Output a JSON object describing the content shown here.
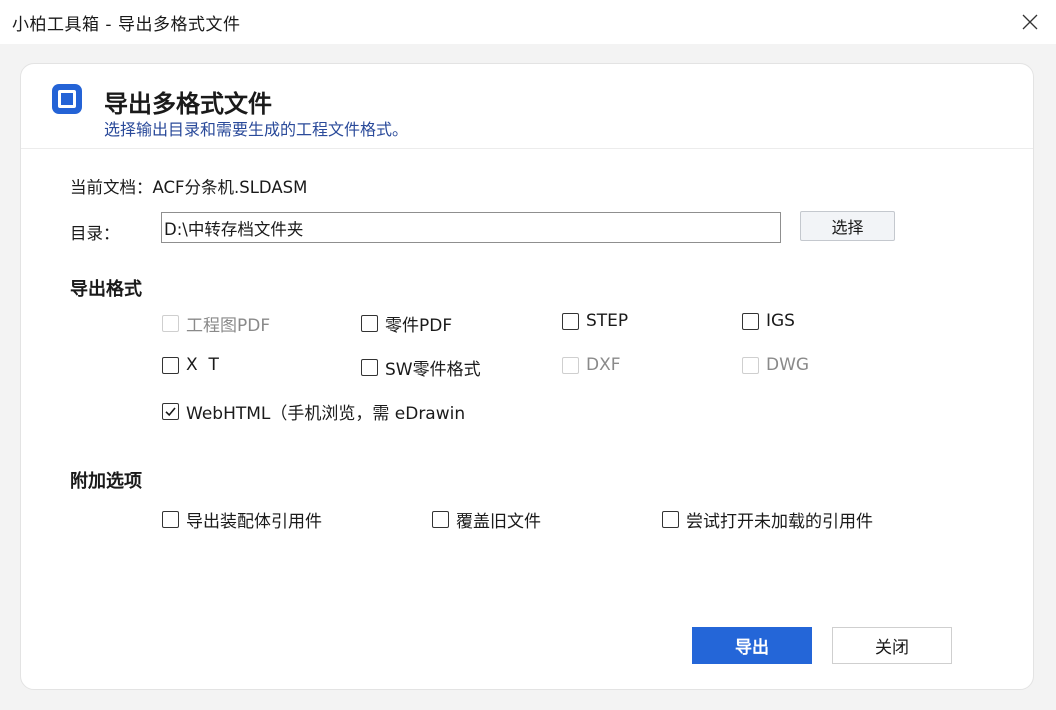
{
  "window": {
    "title": "小柏工具箱 - 导出多格式文件",
    "close_icon": "close-icon"
  },
  "header": {
    "icon": "square-stop-icon",
    "title": "导出多格式文件",
    "subtitle": "选择输出目录和需要生成的工程文件格式。"
  },
  "document": {
    "label": "当前文档：",
    "value": "ACF分条机.SLDASM"
  },
  "directory": {
    "label": "目录：",
    "value": "D:\\中转存档文件夹",
    "choose_label": "选择"
  },
  "formats": {
    "title": "导出格式",
    "items": [
      {
        "label": "工程图PDF",
        "checked": false,
        "enabled": false
      },
      {
        "label": "零件PDF",
        "checked": false,
        "enabled": true
      },
      {
        "label": "STEP",
        "checked": false,
        "enabled": true
      },
      {
        "label": "IGS",
        "checked": false,
        "enabled": true
      },
      {
        "label": "X  T",
        "checked": false,
        "enabled": true
      },
      {
        "label": "SW零件格式",
        "checked": false,
        "enabled": true
      },
      {
        "label": "DXF",
        "checked": false,
        "enabled": false
      },
      {
        "label": "DWG",
        "checked": false,
        "enabled": false
      },
      {
        "label": "WebHTML（手机浏览，需 eDrawin",
        "checked": true,
        "enabled": true
      }
    ]
  },
  "options": {
    "title": "附加选项",
    "items": [
      {
        "label": "导出装配体引用件",
        "checked": false
      },
      {
        "label": "覆盖旧文件",
        "checked": false
      },
      {
        "label": "尝试打开未加载的引用件",
        "checked": false
      }
    ]
  },
  "actions": {
    "export_label": "导出",
    "close_label": "关闭"
  },
  "colors": {
    "accent": "#2466d8",
    "subtitle": "#2a4a9a"
  }
}
